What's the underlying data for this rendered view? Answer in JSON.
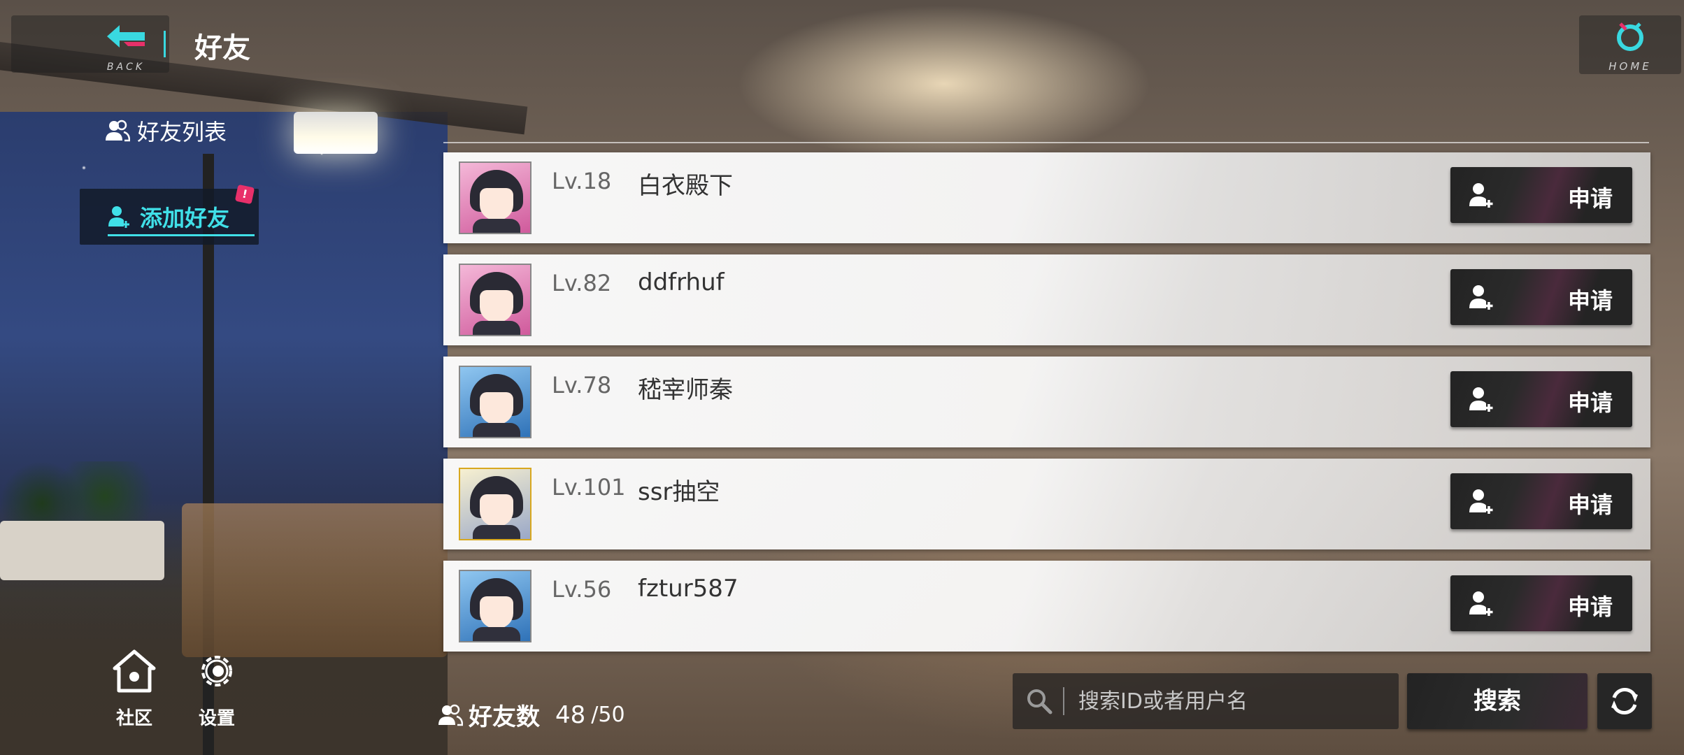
{
  "header": {
    "back_label": "BACK",
    "title": "好友",
    "home_label": "HOME"
  },
  "sidebar": {
    "items": [
      {
        "label": "好友列表",
        "icon": "friends-icon",
        "active": false
      },
      {
        "label": "添加好友",
        "icon": "add-friend-icon",
        "active": true,
        "badge": "!"
      }
    ]
  },
  "friends": [
    {
      "level": "Lv.18",
      "name": "白衣殿下",
      "avatar": "pink",
      "action": "申请"
    },
    {
      "level": "Lv.82",
      "name": "ddfrhuf",
      "avatar": "pink",
      "action": "申请"
    },
    {
      "level": "Lv.78",
      "name": "嵇宰师秦",
      "avatar": "blue",
      "action": "申请"
    },
    {
      "level": "Lv.101",
      "name": "ssr抽空",
      "avatar": "gold",
      "action": "申请"
    },
    {
      "level": "Lv.56",
      "name": "fztur587",
      "avatar": "blue",
      "action": "申请"
    }
  ],
  "bottom_nav": {
    "community_label": "社区",
    "settings_label": "设置"
  },
  "friend_count": {
    "label": "好友数",
    "current": "48",
    "max": "/50"
  },
  "search": {
    "placeholder": "搜索ID或者用户名",
    "button_label": "搜索"
  },
  "colors": {
    "accent": "#39d8e0",
    "badge": "#e8306a",
    "button_dark": "#232323"
  }
}
